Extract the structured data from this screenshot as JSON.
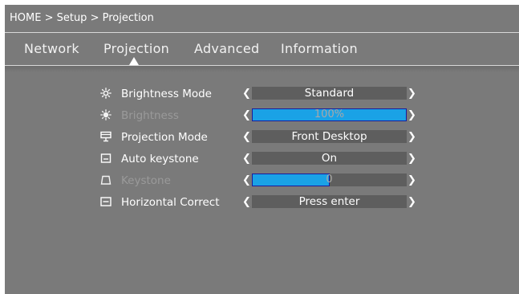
{
  "breadcrumb": "HOME > Setup > Projection",
  "tabs": [
    {
      "label": "Network"
    },
    {
      "label": "Projection"
    },
    {
      "label": "Advanced"
    },
    {
      "label": "Information"
    }
  ],
  "active_tab": "Projection",
  "colors": {
    "panel_background": "#7a7a7a",
    "value_box": "#5e5e5e",
    "progress_fill": "#1aa2e6",
    "disabled_text": "#9a9a9a"
  },
  "settings": [
    {
      "label": "Brightness Mode",
      "icon": "sun-icon",
      "value": "Standard",
      "disabled": false
    },
    {
      "label": "Brightness",
      "icon": "sun-icon",
      "value": "100%",
      "progress": 1.0,
      "disabled": true
    },
    {
      "label": "Projection Mode",
      "icon": "projector-icon",
      "value": "Front Desktop",
      "disabled": false
    },
    {
      "label": "Auto keystone",
      "icon": "keystone-icon",
      "value": "On",
      "disabled": false
    },
    {
      "label": "Keystone",
      "icon": "trapezoid-icon",
      "value": "0",
      "progress": 0.5,
      "disabled": true
    },
    {
      "label": "Horizontal Correct",
      "icon": "horizontal-correct-icon",
      "value": "Press enter",
      "disabled": false
    }
  ],
  "arrows": {
    "left": "❮",
    "right": "❯"
  }
}
